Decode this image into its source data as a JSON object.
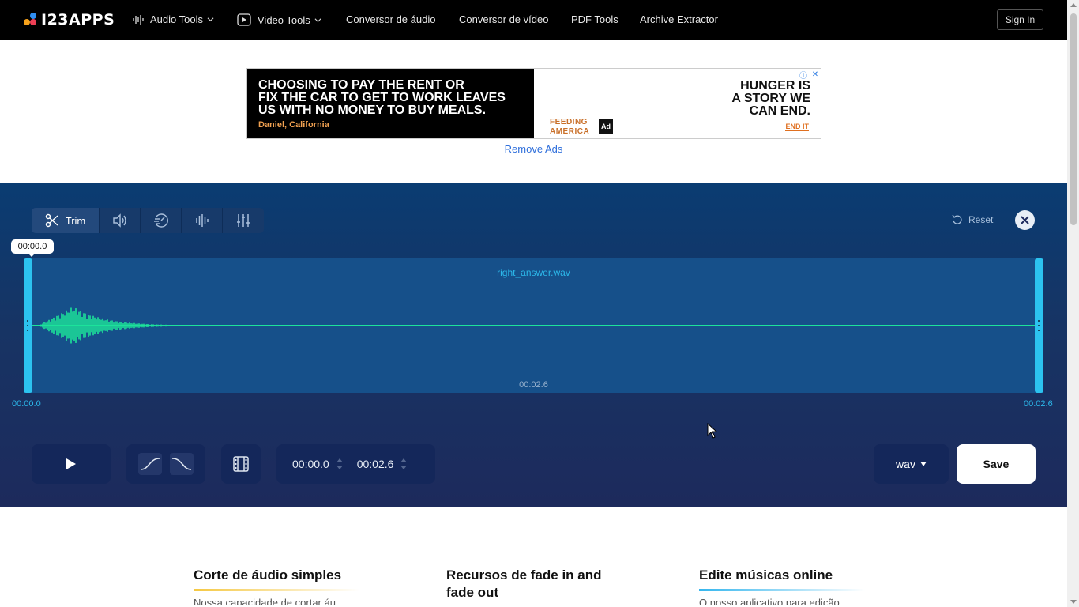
{
  "brand": {
    "logo_text": "I23APPS"
  },
  "nav": {
    "items": [
      {
        "label": "Audio Tools",
        "icon": "waveform-icon",
        "dropdown": true
      },
      {
        "label": "Video Tools",
        "icon": "video-icon",
        "dropdown": true
      },
      {
        "label": "Conversor de áudio"
      },
      {
        "label": "Conversor de vídeo"
      },
      {
        "label": "PDF Tools"
      },
      {
        "label": "Archive Extractor"
      }
    ],
    "sign_in": "Sign In"
  },
  "ad": {
    "headline": [
      "CHOOSING TO PAY THE RENT OR",
      "FIX THE CAR TO GET TO WORK LEAVES",
      "US WITH NO MONEY TO BUY MEALS."
    ],
    "attribution": "Daniel, California",
    "right_headline": [
      "HUNGER IS",
      "A STORY WE",
      "CAN END."
    ],
    "cta": "END IT",
    "sponsor": [
      "FEEDING",
      "AMERICA"
    ],
    "council": "Ad",
    "remove_ads": "Remove Ads"
  },
  "editor": {
    "tools": [
      {
        "label": "Trim",
        "icon": "scissors-icon",
        "active": true
      },
      {
        "icon": "volume-icon"
      },
      {
        "icon": "speed-icon"
      },
      {
        "icon": "equalizer-icon"
      },
      {
        "icon": "sliders-icon"
      }
    ],
    "reset_label": "Reset",
    "cursor_time": "00:00.0",
    "file_name": "right_answer.wav",
    "duration": "00:02.6",
    "timeline_start": "00:00.0",
    "timeline_end": "00:02.6",
    "start_time": "00:00.0",
    "end_time": "00:02.6",
    "format": "wav",
    "save_label": "Save",
    "waveform_color": "#1de39a",
    "handle_color": "#2cc3f0"
  },
  "features": [
    {
      "title": "Corte de áudio simples",
      "peek": "Nossa capacidade de cortar áu",
      "accent": "#f5c842"
    },
    {
      "title": "Recursos de fade in and fade out",
      "peek": "",
      "accent": "#f28a6b"
    },
    {
      "title": "Edite músicas online",
      "peek": "O nosso aplicativo para edição",
      "accent": "#35b6ee"
    }
  ]
}
